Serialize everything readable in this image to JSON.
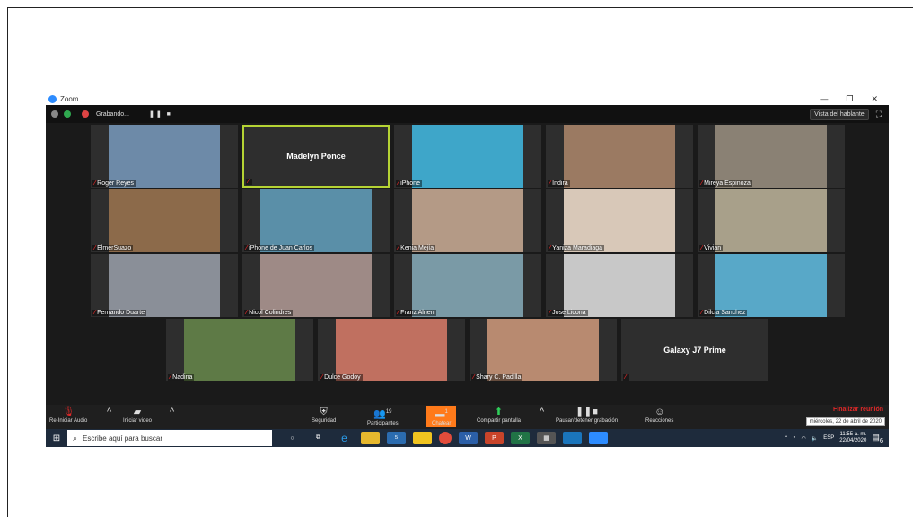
{
  "window": {
    "title": "Zoom",
    "min": "—",
    "restore": "❐",
    "close": "✕"
  },
  "topbar": {
    "recording": "Grabando...",
    "pause": "❚❚ ■",
    "speaker_view": "Vista del hablante",
    "fullscreen": "⛶"
  },
  "tiles": [
    {
      "name": "Roger Reyes",
      "bg": "#6d8aa8"
    },
    {
      "name": "",
      "center": "Madelyn Ponce",
      "active": true
    },
    {
      "name": "iPhone",
      "bg": "#3ea6c9"
    },
    {
      "name": "Indira",
      "bg": "#9b7a62"
    },
    {
      "name": "Mireya Espinoza",
      "bg": "#8a8174"
    },
    {
      "name": "ElmerSuazo",
      "bg": "#8c6a4a"
    },
    {
      "name": "iPhone de Juan Carlos",
      "bg": "#5a8fa8"
    },
    {
      "name": "Kenia Mejía",
      "bg": "#b49a86"
    },
    {
      "name": "Yaniza Maradiaga",
      "bg": "#d8c8b8"
    },
    {
      "name": "Vivian",
      "bg": "#a8a08a"
    },
    {
      "name": "Fernando Duarte",
      "bg": "#8a8f98"
    },
    {
      "name": "Nicol Colindres",
      "bg": "#9e8a86"
    },
    {
      "name": "Franz Alnen",
      "bg": "#7a9aa6"
    },
    {
      "name": "Jose Licona",
      "bg": "#c8c8c8"
    },
    {
      "name": "Dilcia Sanchez",
      "bg": "#58a8c8"
    },
    {
      "name": "Nadina",
      "bg": "#5e7a46"
    },
    {
      "name": "Dulce Godoy",
      "bg": "#c07060"
    },
    {
      "name": "Shary C. Padilla",
      "bg": "#b88a70"
    },
    {
      "name": "",
      "center": "Galaxy J7 Prime"
    }
  ],
  "controls": {
    "audio": "Re-Iniciar Audio",
    "video": "Iniciar video",
    "security": "Seguridad",
    "participants": "Participantes",
    "participants_count": "19",
    "chat": "Chatear",
    "chat_count": "1",
    "share": "Compartir pantalla",
    "record": "Pausar/detener grabación",
    "reactions": "Reacciones",
    "end": "Finalizar reunión",
    "date_tooltip": "miércoles, 22 de abril de 2020"
  },
  "taskbar": {
    "search_placeholder": "Escribe aquí para buscar",
    "language": "ESP",
    "time": "11:55 a. m.",
    "date": "22/04/2020",
    "notif_count": "6",
    "mail_badge": "5"
  }
}
